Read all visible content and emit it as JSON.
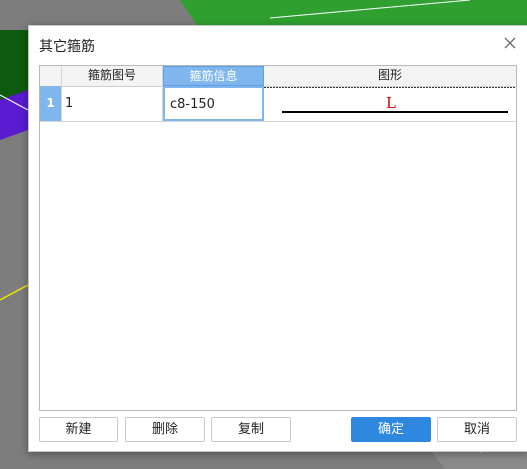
{
  "dialog": {
    "title": "其它箍筋",
    "close_icon": "close-icon"
  },
  "grid": {
    "columns": [
      "",
      "箍筋图号",
      "箍筋信息",
      "图形"
    ],
    "rows": [
      {
        "num": "1",
        "figure_no": "1",
        "info": "c8-150",
        "shape_label": "L"
      }
    ]
  },
  "buttons": {
    "new": "新建",
    "delete": "删除",
    "copy": "复制",
    "ok": "确定",
    "cancel": "取消"
  },
  "colors": {
    "accent": "#2f88e0",
    "header_active": "#7fb6ee",
    "shape_label": "#cc0000"
  }
}
